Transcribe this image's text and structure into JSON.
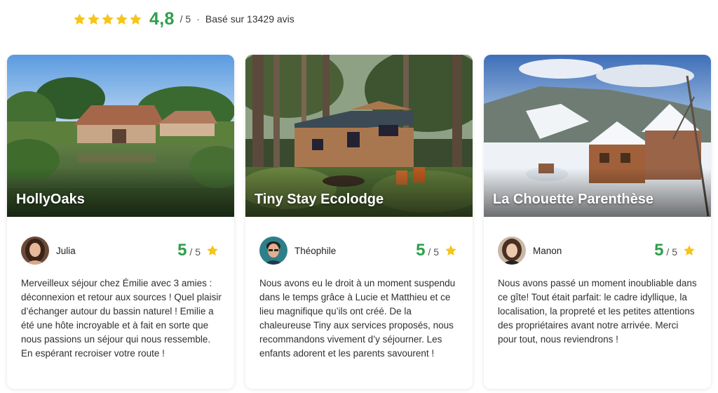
{
  "summary": {
    "star_count": 5,
    "average": "4,8",
    "max": "/ 5",
    "separator": "·",
    "based_on": "Basé sur 13429 avis",
    "star_color": "#f5c518",
    "score_color": "#2e9e4b"
  },
  "cards": [
    {
      "name": "HollyOaks",
      "image": "pond-and-stone-barn-photo",
      "reviewer": "Julia",
      "score": "5",
      "max": "/ 5",
      "text": "Merveilleux séjour chez Émilie avec 3 amies : déconnexion et retour aux sources ! Quel plaisir d’échanger autour du bassin naturel ! Emilie a été une hôte incroyable et à fait en sorte que nous passions un séjour qui nous ressemble. En espérant recroiser votre route !"
    },
    {
      "name": "Tiny Stay Ecolodge",
      "image": "tiny-house-in-forest-photo",
      "reviewer": "Théophile",
      "score": "5",
      "max": "/ 5",
      "text": "Nous avons eu le droit à un moment suspendu dans le temps grâce à Lucie et Matthieu et ce lieu magnifique qu’ils ont créé. De la chaleureuse Tiny aux services proposés, nous recommandons vivement d’y séjourner. Les enfants adorent et les parents savourent !"
    },
    {
      "name": "La Chouette Parenthèse",
      "image": "snowy-chalet-mountain-photo",
      "reviewer": "Manon",
      "score": "5",
      "max": "/ 5",
      "text": "Nous avons passé un moment inoubliable dans ce gîte! Tout était parfait: le cadre idyllique, la localisation, la propreté et les petites attentions des propriétaires avant notre arrivée. Merci pour tout, nous reviendrons !"
    }
  ]
}
